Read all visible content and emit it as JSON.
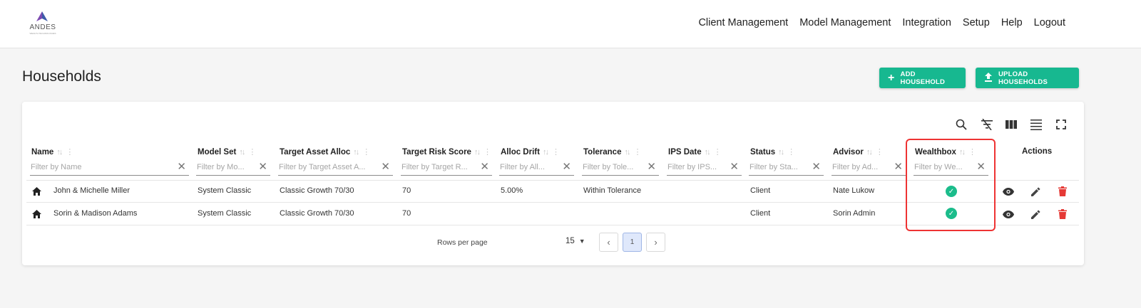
{
  "brand": {
    "name": "ANDES",
    "tagline": "WEALTH TECHNOLOGIES"
  },
  "nav": [
    "Client Management",
    "Model Management",
    "Integration",
    "Setup",
    "Help",
    "Logout"
  ],
  "page": {
    "title": "Households"
  },
  "buttons": {
    "add": "ADD HOUSEHOLD",
    "upload": "UPLOAD HOUSEHOLDS"
  },
  "table": {
    "columns": [
      {
        "label": "Name",
        "filter": "Filter by Name"
      },
      {
        "label": "Model Set",
        "filter": "Filter by Mo..."
      },
      {
        "label": "Target Asset Alloc",
        "filter": "Filter by Target Asset A..."
      },
      {
        "label": "Target Risk Score",
        "filter": "Filter by Target R..."
      },
      {
        "label": "Alloc Drift",
        "filter": "Filter by All..."
      },
      {
        "label": "Tolerance",
        "filter": "Filter by Tole..."
      },
      {
        "label": "IPS Date",
        "filter": "Filter by IPS..."
      },
      {
        "label": "Status",
        "filter": "Filter by Sta..."
      },
      {
        "label": "Advisor",
        "filter": "Filter by Ad..."
      },
      {
        "label": "Wealthbox",
        "filter": "Filter by We..."
      },
      {
        "label": "Actions"
      }
    ],
    "rows": [
      {
        "name": "John & Michelle Miller",
        "model_set": "System Classic",
        "target_alloc": "Classic Growth 70/30",
        "risk": "70",
        "drift": "5.00%",
        "tolerance": "Within Tolerance",
        "ips": "",
        "status": "Client",
        "advisor": "Nate Lukow",
        "wealthbox": true
      },
      {
        "name": "Sorin & Madison Adams",
        "model_set": "System Classic",
        "target_alloc": "Classic Growth 70/30",
        "risk": "70",
        "drift": "",
        "tolerance": "",
        "ips": "",
        "status": "Client",
        "advisor": "Sorin Admin",
        "wealthbox": true
      }
    ]
  },
  "pagination": {
    "rows_per_page_label": "Rows per page",
    "rows_per_page": "15",
    "current_page": "1"
  },
  "colors": {
    "accent": "#17b890",
    "check": "#1bbc8b",
    "delete": "#e53935",
    "annotation": "#e33333"
  }
}
